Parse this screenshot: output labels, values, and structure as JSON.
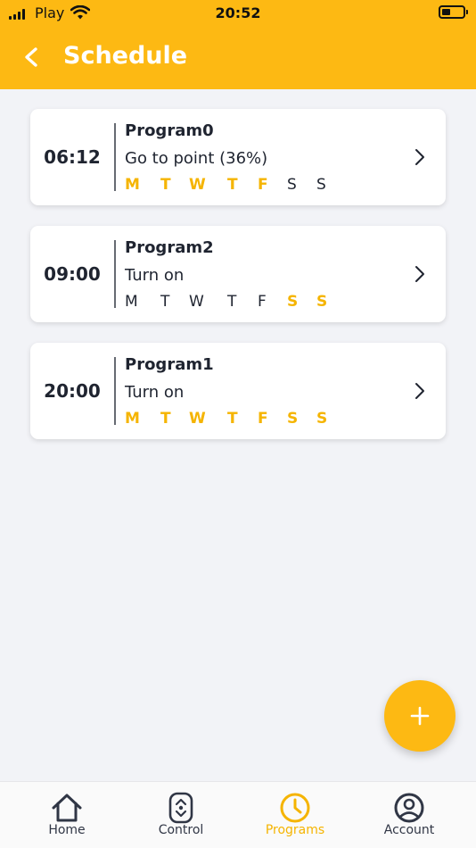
{
  "status_bar": {
    "carrier": "Play",
    "time": "20:52"
  },
  "header": {
    "title": "Schedule"
  },
  "programs": [
    {
      "time": "06:12",
      "name": "Program0",
      "action": "Go to point (36%)",
      "days": [
        {
          "label": "M",
          "active": true
        },
        {
          "label": "T",
          "active": true
        },
        {
          "label": "W",
          "active": true
        },
        {
          "label": "T",
          "active": true
        },
        {
          "label": "F",
          "active": true
        },
        {
          "label": "S",
          "active": false
        },
        {
          "label": "S",
          "active": false
        }
      ]
    },
    {
      "time": "09:00",
      "name": "Program2",
      "action": "Turn on",
      "days": [
        {
          "label": "M",
          "active": false
        },
        {
          "label": "T",
          "active": false
        },
        {
          "label": "W",
          "active": false
        },
        {
          "label": "T",
          "active": false
        },
        {
          "label": "F",
          "active": false
        },
        {
          "label": "S",
          "active": true
        },
        {
          "label": "S",
          "active": true
        }
      ]
    },
    {
      "time": "20:00",
      "name": "Program1",
      "action": "Turn on",
      "days": [
        {
          "label": "M",
          "active": true
        },
        {
          "label": "T",
          "active": true
        },
        {
          "label": "W",
          "active": true
        },
        {
          "label": "T",
          "active": true
        },
        {
          "label": "F",
          "active": true
        },
        {
          "label": "S",
          "active": true
        },
        {
          "label": "S",
          "active": true
        }
      ]
    }
  ],
  "nav": {
    "home": "Home",
    "control": "Control",
    "programs": "Programs",
    "account": "Account"
  },
  "colors": {
    "accent": "#fdb913",
    "active_day": "#f5b400",
    "text": "#1f2430",
    "background": "#f2f3f7"
  },
  "icons": {
    "back": "chevron-left-icon",
    "add": "plus-icon",
    "home": "home-icon",
    "control": "control-icon",
    "programs": "clock-icon",
    "account": "account-icon"
  }
}
